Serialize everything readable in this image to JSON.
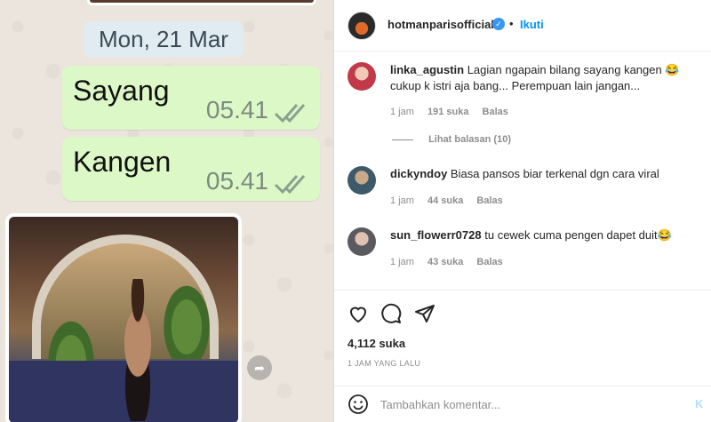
{
  "chat": {
    "date": "Mon, 21 Mar",
    "messages": [
      {
        "text": "Sayang",
        "time": "05.41"
      },
      {
        "text": "Kangen",
        "time": "05.41"
      }
    ]
  },
  "post": {
    "owner": "hotmanparisofficial",
    "separator": "•",
    "follow_label": "Ikuti",
    "verified_icon": "check-icon"
  },
  "comments": [
    {
      "username": "linka_agustin",
      "text": "Lagian ngapain bilang sayang kangen 😂 cukup k istri aja bang... Perempuan lain jangan...",
      "time": "1 jam",
      "likes": "191 suka",
      "reply_label": "Balas"
    },
    {
      "username": "dickyndoy",
      "text": "Biasa pansos biar terkenal dgn cara viral",
      "time": "1 jam",
      "likes": "44 suka",
      "reply_label": "Balas"
    },
    {
      "username": "sun_flowerr0728",
      "text": "tu cewek cuma pengen dapet duit😂",
      "time": "1 jam",
      "likes": "43 suka",
      "reply_label": "Balas"
    }
  ],
  "view_replies": "Lihat balasan (10)",
  "likes_total": "4,112 suka",
  "posted_ago": "1 JAM YANG LALU",
  "add_comment": {
    "placeholder": "Tambahkan komentar...",
    "post_label": "K"
  },
  "colors": {
    "accent": "#0095f6",
    "bubble": "#dcf8c6",
    "chat_bg": "#ece5dd"
  }
}
